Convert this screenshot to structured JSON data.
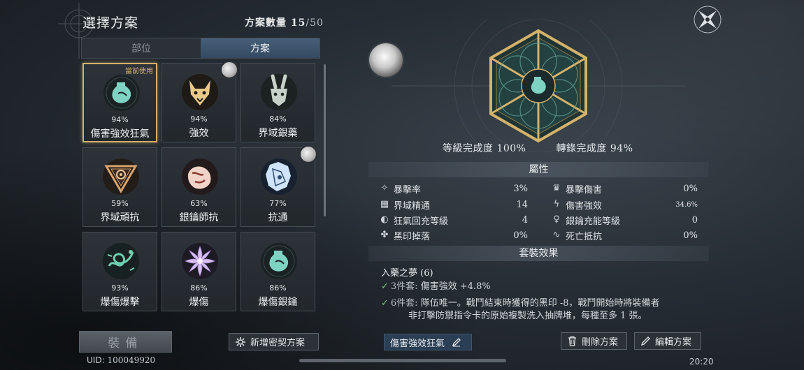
{
  "header": {
    "title": "選擇方案",
    "count_label": "方案數量",
    "count_current": "15",
    "count_max": "/50"
  },
  "tabs": [
    {
      "label": "部位",
      "active": false
    },
    {
      "label": "方案",
      "active": true
    }
  ],
  "current_tag": "當前使用",
  "cards": [
    {
      "name": "傷害強效狂氣",
      "percent": "94%",
      "icon": "flask-icon",
      "selected": true,
      "avatar": false
    },
    {
      "name": "強效",
      "percent": "94%",
      "icon": "wolf-mask-icon",
      "selected": false,
      "avatar": true
    },
    {
      "name": "界域銀藥",
      "percent": "84%",
      "icon": "rabbit-mask-icon",
      "selected": false,
      "avatar": false
    },
    {
      "name": "界域頑抗",
      "percent": "59%",
      "icon": "triangle-sigil-icon",
      "selected": false,
      "avatar": false
    },
    {
      "name": "銀鑰師抗",
      "percent": "63%",
      "icon": "beast-icon",
      "selected": false,
      "avatar": false
    },
    {
      "name": "抗通",
      "percent": "77%",
      "icon": "crystal-icon",
      "selected": false,
      "avatar": true
    },
    {
      "name": "爆傷爆擊",
      "percent": "93%",
      "icon": "serpent-icon",
      "selected": false,
      "avatar": false
    },
    {
      "name": "爆傷",
      "percent": "86%",
      "icon": "flower-icon",
      "selected": false,
      "avatar": false
    },
    {
      "name": "爆傷銀鑰",
      "percent": "86%",
      "icon": "flask-icon",
      "selected": false,
      "avatar": false
    }
  ],
  "equip_label": "裝備",
  "uid": {
    "label": "UID:",
    "value": "100049920"
  },
  "new_plan_label": "新增密契方案",
  "completion": {
    "level": "等級完成度 100%",
    "record": "轉錄完成度 94%"
  },
  "attributes": {
    "title": "屬性",
    "left": [
      {
        "icon": "crit-rate-icon",
        "glyph": "✧",
        "label": "暴擊率",
        "value": "3%"
      },
      {
        "icon": "domain-mastery-icon",
        "glyph": "▦",
        "label": "界域精通",
        "value": "14"
      },
      {
        "icon": "frenzy-recharge-icon",
        "glyph": "◐",
        "label": "狂氣回充等級",
        "value": "4"
      },
      {
        "icon": "black-seal-icon",
        "glyph": "✤",
        "label": "黑印掉落",
        "value": "0%"
      }
    ],
    "right": [
      {
        "icon": "crit-damage-icon",
        "glyph": "♛",
        "label": "暴擊傷害",
        "value": "0%"
      },
      {
        "icon": "damage-boost-icon",
        "glyph": "ϟ",
        "label": "傷害強效",
        "value": "34.6%"
      },
      {
        "icon": "silver-key-icon",
        "glyph": "♀",
        "label": "銀鑰充能等級",
        "value": "0"
      },
      {
        "icon": "death-resist-icon",
        "glyph": "∿",
        "label": "死亡抵抗",
        "value": "0%"
      }
    ]
  },
  "set_effects": {
    "title": "套裝效果",
    "set_name": "入藥之夢 (6)",
    "effect3_label": "3件套:",
    "effect3_text": "傷害強效 +4.8%",
    "effect6_label": "6件套:",
    "effect6_line1": "隊伍唯一。戰鬥結束時獲得的黑印 -8，戰鬥開始時將裝備者",
    "effect6_line2": "非打擊防禦指令卡的原始複製洗入抽牌堆，每種至多 1 張。"
  },
  "plan_name": "傷害強效狂氣",
  "delete_label": "刪除方案",
  "edit_label": "編輯方案",
  "clock": "20:20",
  "colors": {
    "gold": "#d4b26a",
    "teal": "#7fd3c3",
    "tab_active": "#3d546c",
    "check": "#7ec089"
  }
}
